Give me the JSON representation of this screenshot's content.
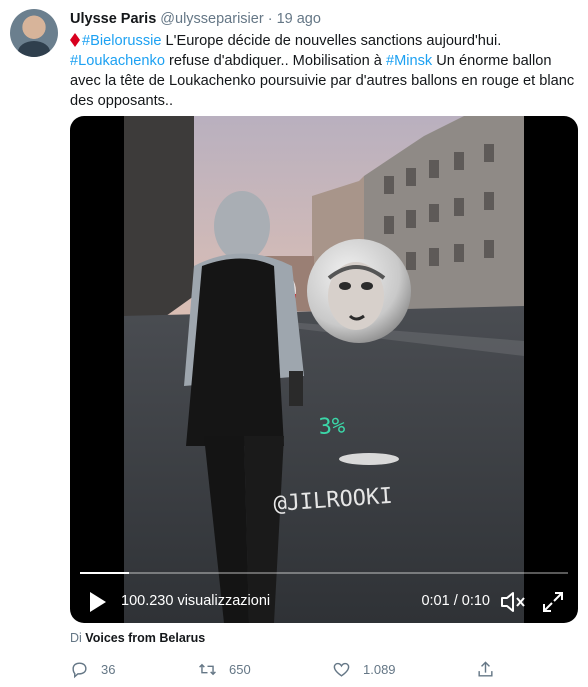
{
  "tweet": {
    "author_name": "Ulysse Paris",
    "handle": "@ulysseparisier",
    "separator": "·",
    "time_ago": "19 ago",
    "text_parts": {
      "tag1": "#Bielorussie",
      "t1": " L'Europe décide de nouvelles sanctions aujourd'hui.",
      "tag2": "#Loukachenko",
      "t2": " refuse d'abdiquer.. Mobilisation à ",
      "tag3": "#Minsk",
      "t3": " Un énorme ballon avec la tête de Loukachenko poursuivie par d'autres ballons en rouge et blanc des opposants.."
    }
  },
  "video": {
    "views": "100.230 visualizzazioni",
    "time": "0:01 / 0:10",
    "progress": 0.1,
    "overlay": {
      "graffiti_green": "3%",
      "graffiti_white": "@JILROOKI"
    }
  },
  "via": {
    "prefix": "Di",
    "source": "Voices from Belarus"
  },
  "actions": {
    "replies": "36",
    "retweets": "650",
    "likes": "1.089"
  },
  "colors": {
    "accent": "#1da1f2",
    "muted": "#657786",
    "text": "#14171a",
    "retweet": "#17bf63",
    "like": "#e0245e"
  },
  "icons": [
    "red-diamond-icon",
    "play-icon",
    "volume-icon",
    "fullscreen-icon",
    "reply-icon",
    "retweet-icon",
    "like-icon",
    "share-icon"
  ]
}
